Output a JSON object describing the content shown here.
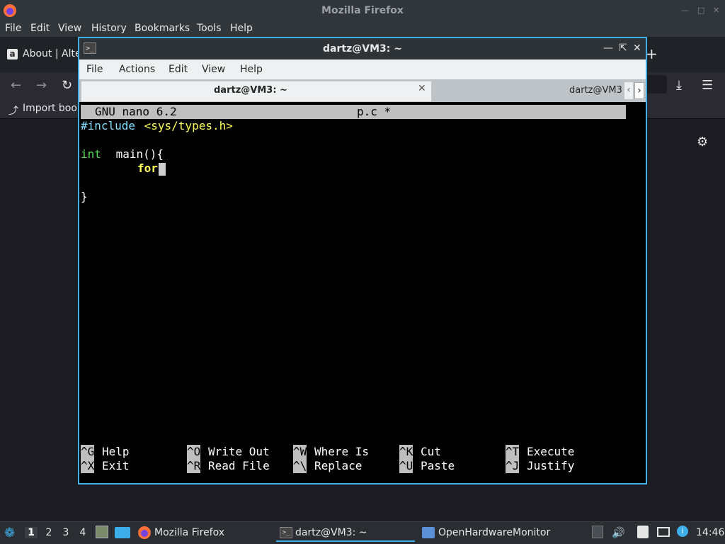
{
  "firefox": {
    "window_title": "Mozilla Firefox",
    "menu": [
      "File",
      "Edit",
      "View",
      "History",
      "Bookmarks",
      "Tools",
      "Help"
    ],
    "tab_label": "About | Alte",
    "tab_icon_letter": "a",
    "bookmark_item": "Import book",
    "new_tab": "+"
  },
  "terminal": {
    "window_title": "dartz@VM3: ~",
    "menu": [
      "File",
      "Actions",
      "Edit",
      "View",
      "Help"
    ],
    "tabs": [
      {
        "label": "dartz@VM3: ~",
        "active": true
      },
      {
        "label": "dartz@VM3",
        "active": false
      }
    ]
  },
  "nano": {
    "version": "GNU nano 6.2",
    "filename": "p.c *",
    "code": {
      "l1_directive": "#include",
      "l1_header": " <sys/types.h>",
      "l3_type": "int",
      "l3_rest": " main(){",
      "l4": "for",
      "l6": "}"
    },
    "shortcuts_row1": [
      {
        "key": "^G",
        "label": "Help"
      },
      {
        "key": "^O",
        "label": "Write Out"
      },
      {
        "key": "^W",
        "label": "Where Is"
      },
      {
        "key": "^K",
        "label": "Cut"
      },
      {
        "key": "^T",
        "label": "Execute"
      }
    ],
    "shortcuts_row2": [
      {
        "key": "^X",
        "label": "Exit"
      },
      {
        "key": "^R",
        "label": "Read File"
      },
      {
        "key": "^\\",
        "label": "Replace"
      },
      {
        "key": "^U",
        "label": "Paste"
      },
      {
        "key": "^J",
        "label": "Justify"
      }
    ]
  },
  "taskbar": {
    "desktops": [
      "1",
      "2",
      "3",
      "4"
    ],
    "apps": [
      "Mozilla Firefox",
      "dartz@VM3: ~",
      "OpenHardwareMonitor"
    ],
    "clock": "14:46"
  },
  "colors": {
    "accent": "#3daee9",
    "terminal_bg": "#000000",
    "nano_header_bg": "#bfbfbf"
  }
}
